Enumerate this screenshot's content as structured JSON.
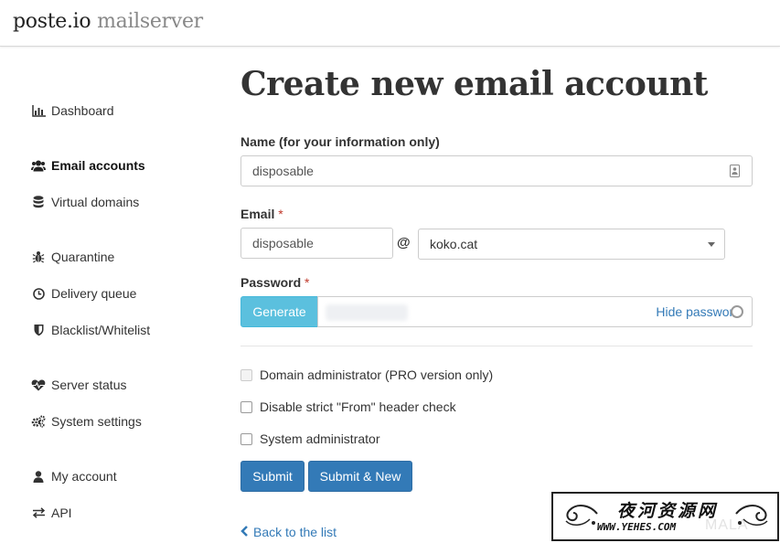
{
  "brand": {
    "name": "poste.io",
    "sub": "mailserver"
  },
  "sidebar": {
    "items": [
      {
        "label": "Dashboard",
        "icon": "bar-chart-icon"
      },
      {
        "label": "Email accounts",
        "icon": "users-icon",
        "active": true
      },
      {
        "label": "Virtual domains",
        "icon": "database-icon"
      },
      {
        "label": "Quarantine",
        "icon": "bug-icon"
      },
      {
        "label": "Delivery queue",
        "icon": "clock-icon"
      },
      {
        "label": "Blacklist/Whitelist",
        "icon": "shield-icon"
      },
      {
        "label": "Server status",
        "icon": "heartbeat-icon"
      },
      {
        "label": "System settings",
        "icon": "cogs-icon"
      },
      {
        "label": "My account",
        "icon": "user-icon"
      },
      {
        "label": "API",
        "icon": "exchange-icon"
      }
    ]
  },
  "page": {
    "title": "Create new email account"
  },
  "form": {
    "name_label": "Name (for your information only)",
    "name_value": "disposable",
    "email_label": "Email",
    "required_mark": "*",
    "email_local_value": "disposable",
    "at_sign": "@",
    "email_domain_value": "koko.cat",
    "password_label": "Password",
    "generate_label": "Generate",
    "hide_password_label": "Hide password",
    "checkboxes": [
      {
        "label": "Domain administrator (PRO version only)",
        "checked": false,
        "disabled": true
      },
      {
        "label": "Disable strict \"From\" header check",
        "checked": false,
        "disabled": false
      },
      {
        "label": "System administrator",
        "checked": false,
        "disabled": false
      }
    ],
    "submit_label": "Submit",
    "submit_new_label": "Submit & New",
    "back_label": "Back to the list"
  },
  "watermark": {
    "title": "夜河资源网",
    "url": "WWW.YEHES.COM",
    "ghost": "MALA"
  },
  "colors": {
    "primary": "#337ab7",
    "info": "#5bc0de",
    "required": "#c0392b"
  }
}
